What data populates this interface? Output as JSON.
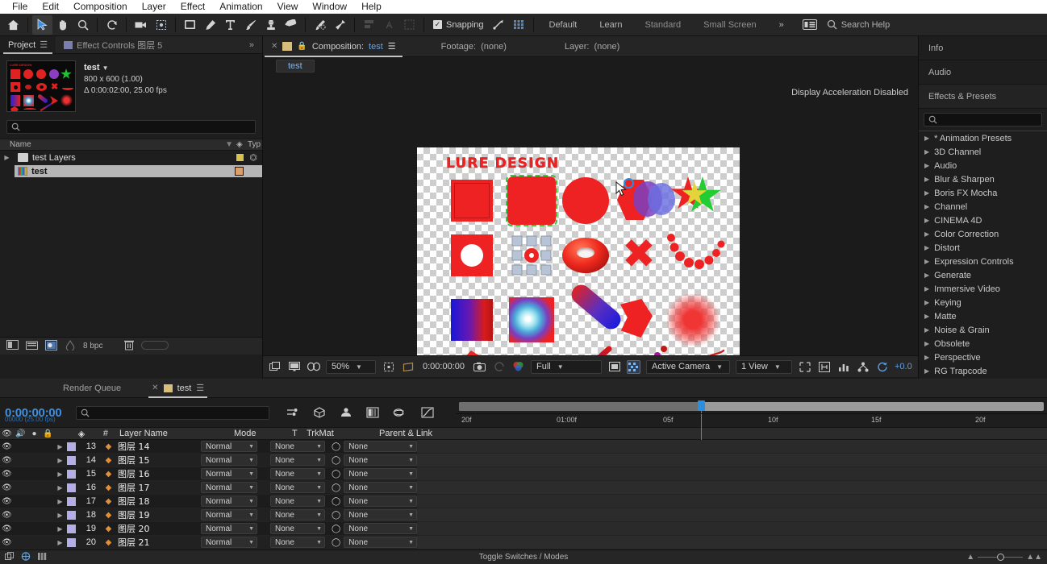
{
  "menubar": {
    "items": [
      "File",
      "Edit",
      "Composition",
      "Layer",
      "Effect",
      "Animation",
      "View",
      "Window",
      "Help"
    ]
  },
  "toolbar": {
    "tools": [
      {
        "name": "home-icon",
        "glyph": "⌂"
      },
      {
        "name": "selection-tool-icon",
        "glyph": "➤"
      },
      {
        "name": "hand-tool-icon",
        "glyph": "✋"
      },
      {
        "name": "zoom-tool-icon",
        "glyph": "⚲"
      },
      {
        "name": "rotation-tool-icon",
        "glyph": "↺"
      },
      {
        "name": "camera-tool-icon",
        "glyph": "◰"
      },
      {
        "name": "pan-behind-tool-icon",
        "glyph": "✣"
      },
      {
        "name": "shape-tool-icon",
        "glyph": "□"
      },
      {
        "name": "pen-tool-icon",
        "glyph": "✒"
      },
      {
        "name": "type-tool-icon",
        "glyph": "T"
      },
      {
        "name": "brush-tool-icon",
        "glyph": "✐"
      },
      {
        "name": "clone-stamp-tool-icon",
        "glyph": "☖"
      },
      {
        "name": "eraser-tool-icon",
        "glyph": "◆"
      },
      {
        "name": "roto-brush-tool-icon",
        "glyph": "✄"
      },
      {
        "name": "puppet-pin-tool-icon",
        "glyph": "✹"
      }
    ],
    "dim_tools": [
      {
        "name": "align-icon",
        "glyph": "⧉"
      },
      {
        "name": "text-align-icon",
        "glyph": "A"
      },
      {
        "name": "mask-icon",
        "glyph": "❖"
      }
    ],
    "snapping_label": "Snapping",
    "snapping_checked": true,
    "snap_icons": [
      {
        "name": "snap-arrow-icon",
        "glyph": "↗"
      },
      {
        "name": "snap-grid-icon",
        "glyph": "░"
      }
    ],
    "workspaces": [
      "Default",
      "Learn",
      "Standard",
      "Small Screen"
    ],
    "overflow_label": "»",
    "workspace_menu_icon": "workspace-menu-icon",
    "search_help_placeholder": "Search Help"
  },
  "project_panel": {
    "tabs": [
      {
        "label": "Project",
        "active": true,
        "has_menu": true
      },
      {
        "label": "Effect Controls 图层 5",
        "active": false,
        "has_menu": false
      }
    ],
    "overflow": "»",
    "item": {
      "name": "test",
      "dimensions": "800 x 600 (1.00)",
      "duration": "Δ 0:00:02:00, 25.00 fps"
    },
    "search_placeholder": "",
    "columns": {
      "name": "Name",
      "type": "Typ"
    },
    "rows": [
      {
        "label": "test Layers",
        "kind": "folder",
        "selected": false,
        "swatch": "#d8c34a",
        "has_twisty": true
      },
      {
        "label": "test",
        "kind": "comp",
        "selected": true,
        "swatch": "#d9a06a",
        "has_twisty": false
      }
    ],
    "footer": {
      "bpc_label": "8 bpc",
      "icons": [
        "new-comp-icon",
        "new-folder-icon",
        "project-settings-icon",
        "color-depth-icon",
        "delete-icon"
      ]
    }
  },
  "comp_panel": {
    "tabs": [
      {
        "label": "Composition:",
        "value": "test",
        "active": true,
        "closable": true,
        "locked": true,
        "has_menu": true
      },
      {
        "label": "Footage:",
        "value": "(none)",
        "active": false
      },
      {
        "label": "Layer:",
        "value": "(none)",
        "active": false
      }
    ],
    "sub_tab": "test",
    "overlay_message": "Display Acceleration Disabled",
    "canvas_title": "LURE DESIGN",
    "bottom_bar": {
      "toggle_icons": [
        "main-viewer-icon",
        "toggle-transparency-grid-icon",
        "toggle-mask-icon"
      ],
      "magnification": "50%",
      "region_icons": [
        "region-of-interest-icon",
        "proportional-grid-icon"
      ],
      "timecode": "0:00:00:00",
      "snapshot_icon": "camera-icon",
      "show_snapshot_icon": "show-snapshot-icon",
      "channel_icon": "show-channel-icon",
      "resolution": "Full",
      "preview_icons": [
        "region-preview-icon",
        "transparency-icon"
      ],
      "camera": "Active Camera",
      "views": "1 View",
      "right_icons": [
        "pixel-aspect-icon",
        "fast-previews-icon",
        "timeline-icon",
        "comp-flowchart-icon",
        "reset-exposure-icon"
      ],
      "exposure": "+0.0"
    }
  },
  "right_panel": {
    "tabs": [
      "Info",
      "Audio",
      "Effects & Presets"
    ],
    "search_placeholder": "",
    "categories": [
      "* Animation Presets",
      "3D Channel",
      "Audio",
      "Blur & Sharpen",
      "Boris FX Mocha",
      "Channel",
      "CINEMA 4D",
      "Color Correction",
      "Distort",
      "Expression Controls",
      "Generate",
      "Immersive Video",
      "Keying",
      "Matte",
      "Noise & Grain",
      "Obsolete",
      "Perspective",
      "RG Trapcode"
    ]
  },
  "timeline_panel": {
    "tabs": [
      {
        "label": "Render Queue",
        "active": false,
        "closable": false
      },
      {
        "label": "test",
        "active": true,
        "closable": true,
        "has_menu": true
      }
    ],
    "current_time": "0:00:00:00",
    "frame_rate_note": "00000 (25.00 fps)",
    "search_placeholder": "",
    "switch_icons": [
      "live-update-icon",
      "draft-3d-icon",
      "hide-shy-icon",
      "frame-blend-icon",
      "motion-blur-icon",
      "graph-editor-icon"
    ],
    "column_headers": {
      "visibility": "eye-icon",
      "audio": "audio-icon",
      "solo": "solo-icon",
      "lock": "lock-icon",
      "label": "label-icon",
      "number": "#",
      "layer_name": "Layer Name",
      "mode": "Mode",
      "t": "T",
      "trkmat": "TrkMat",
      "parent": "Parent & Link"
    },
    "ruler_labels": [
      "20f",
      "01:00f",
      "05f",
      "10f",
      "15f",
      "20f"
    ],
    "layers": [
      {
        "num": "13",
        "name": "图层 14",
        "mode": "Normal",
        "trkmat": "None",
        "parent": "None"
      },
      {
        "num": "14",
        "name": "图层 15",
        "mode": "Normal",
        "trkmat": "None",
        "parent": "None"
      },
      {
        "num": "15",
        "name": "图层 16",
        "mode": "Normal",
        "trkmat": "None",
        "parent": "None"
      },
      {
        "num": "16",
        "name": "图层 17",
        "mode": "Normal",
        "trkmat": "None",
        "parent": "None"
      },
      {
        "num": "17",
        "name": "图层 18",
        "mode": "Normal",
        "trkmat": "None",
        "parent": "None"
      },
      {
        "num": "18",
        "name": "图层 19",
        "mode": "Normal",
        "trkmat": "None",
        "parent": "None"
      },
      {
        "num": "19",
        "name": "图层 20",
        "mode": "Normal",
        "trkmat": "None",
        "parent": "None"
      },
      {
        "num": "20",
        "name": "图层 21",
        "mode": "Normal",
        "trkmat": "None",
        "parent": "None"
      }
    ],
    "footer": {
      "toggle_label": "Toggle Switches / Modes",
      "left_icons": [
        "comp-mini-flowchart-icon",
        "3d-renderer-icon",
        "layer-switches-icon"
      ]
    }
  },
  "colors": {
    "accent_blue": "#3f8fe0",
    "shape_red": "#ee2222",
    "panel_bg": "#1e1e1e",
    "toolbar_bg": "#262626",
    "green_bar": "#2c9a3f",
    "label_purple": "#b3aee4"
  }
}
